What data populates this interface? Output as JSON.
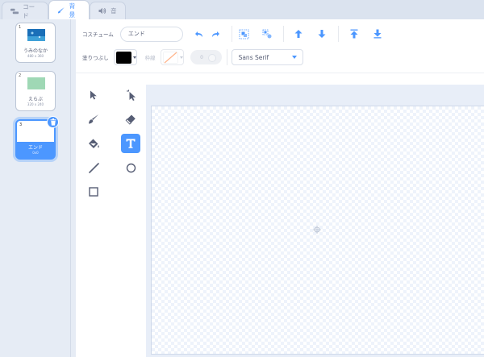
{
  "tabs": [
    {
      "label": "コード",
      "icon": "code-icon",
      "active": false
    },
    {
      "label": "背景",
      "icon": "brush-icon",
      "active": true
    },
    {
      "label": "音",
      "icon": "speaker-icon",
      "active": false
    }
  ],
  "costumes": [
    {
      "number": "1",
      "name": "うみのなか",
      "size": "480 x 360",
      "thumb_color": "#1a7bc4"
    },
    {
      "number": "2",
      "name": "えらぶ",
      "size": "320 x 240",
      "thumb_color": "#9fd8b5"
    },
    {
      "number": "3",
      "name": "エンド",
      "size": "0x0",
      "thumb_color": "#ffffff",
      "selected": true
    }
  ],
  "editor": {
    "costume_label": "コスチューム",
    "costume_name": "エンド",
    "fill_label": "塗りつぶし",
    "fill_color": "#000000",
    "outline_label": "枠線",
    "outline_value": "0",
    "font": "Sans Serif"
  },
  "tools": [
    {
      "name": "select-tool",
      "active": false
    },
    {
      "name": "reshape-tool",
      "active": false
    },
    {
      "name": "brush-tool",
      "active": false
    },
    {
      "name": "eraser-tool",
      "active": false
    },
    {
      "name": "fill-tool",
      "active": false
    },
    {
      "name": "text-tool",
      "active": true
    },
    {
      "name": "line-tool",
      "active": false
    },
    {
      "name": "circle-tool",
      "active": false
    },
    {
      "name": "rectangle-tool",
      "active": false
    }
  ],
  "colors": {
    "accent": "#4c97ff",
    "canvas_border": "#cfd9ea"
  }
}
